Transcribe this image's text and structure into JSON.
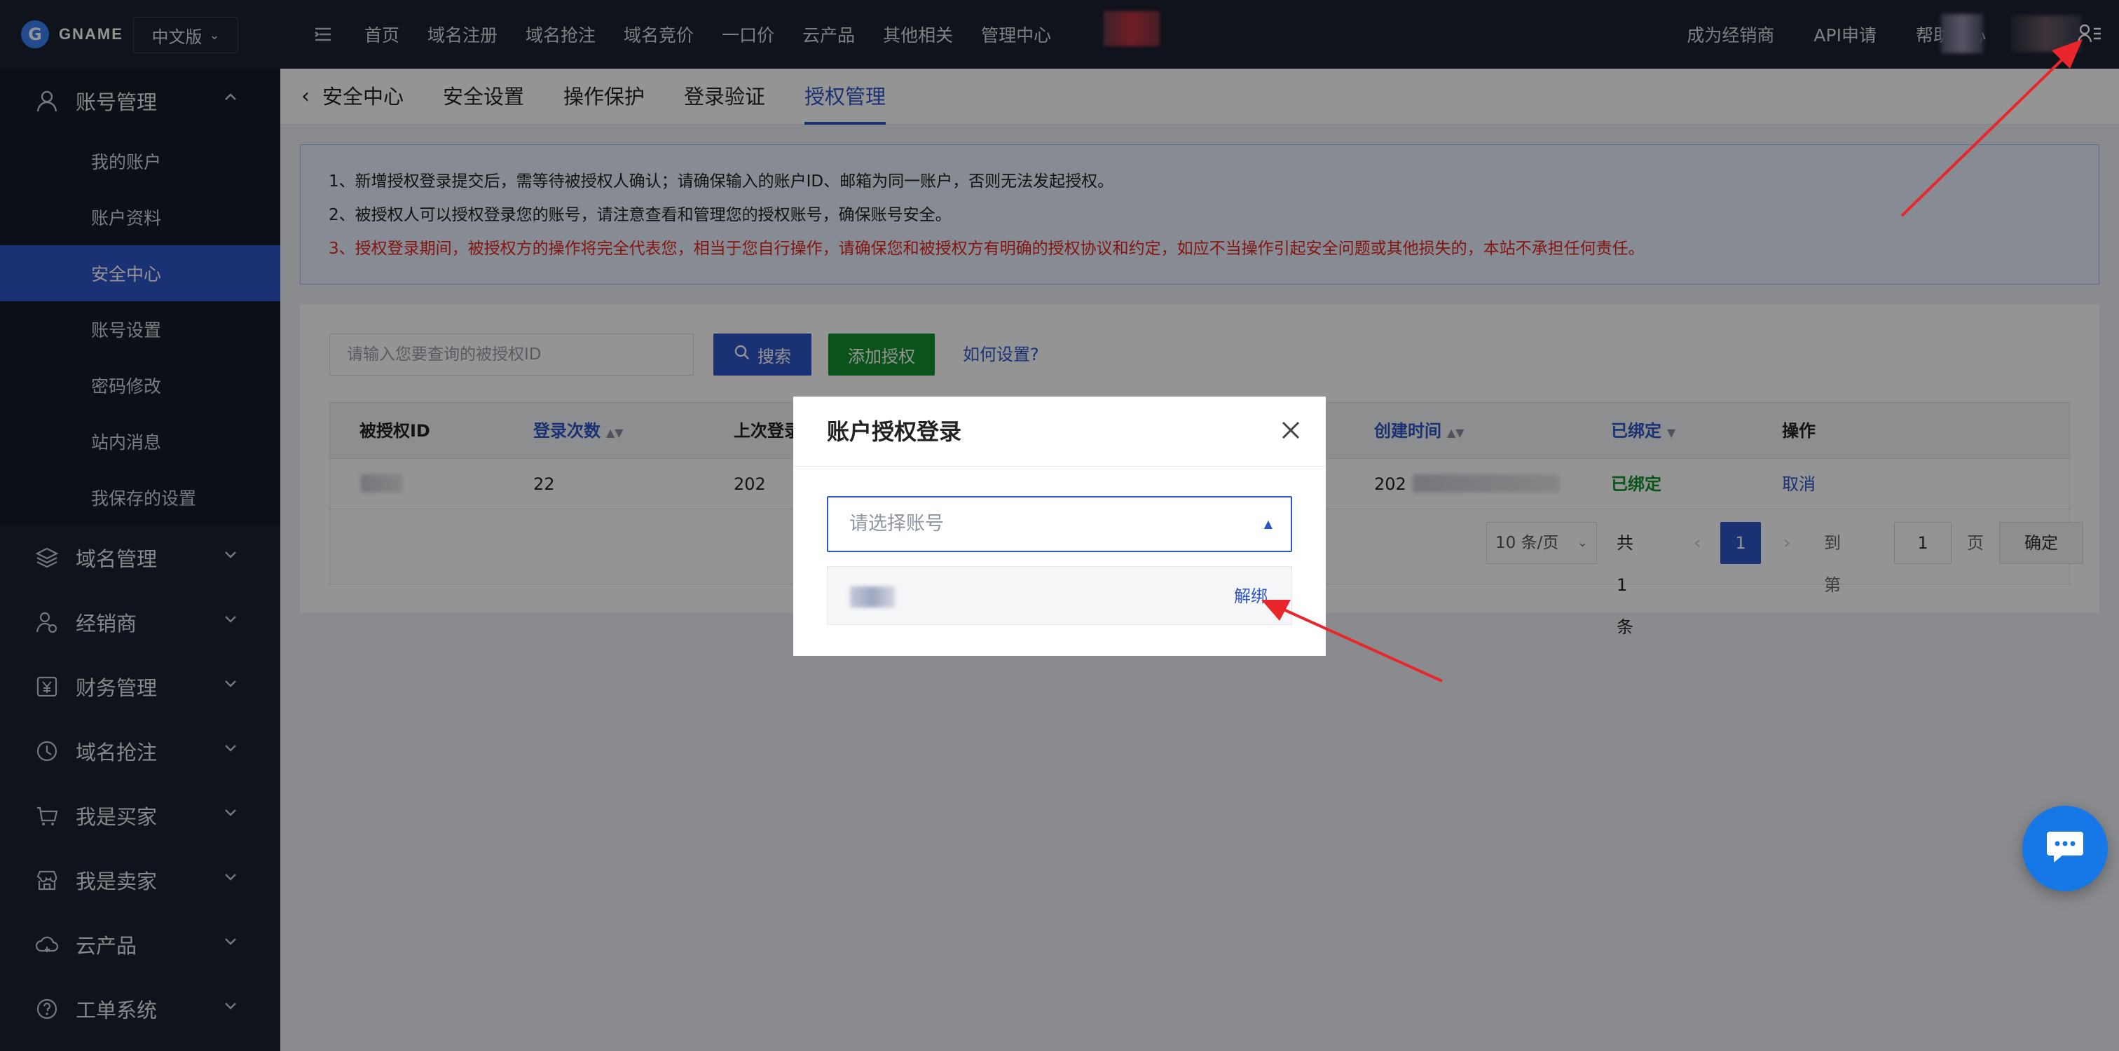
{
  "topbar": {
    "logo_text": "GNAME",
    "language": "中文版",
    "nav": [
      "首页",
      "域名注册",
      "域名抢注",
      "域名竞价",
      "一口价",
      "云产品",
      "其他相关",
      "管理中心"
    ],
    "nav_right": [
      "成为经销商",
      "API申请",
      "帮助中心"
    ],
    "icons": [
      "menu-toggle-icon",
      "user-menu-icon"
    ]
  },
  "sidebar": {
    "account_group": "账号管理",
    "account_items": [
      "我的账户",
      "账户资料",
      "安全中心",
      "账号设置",
      "密码修改",
      "站内消息",
      "我保存的设置"
    ],
    "active_item": "安全中心",
    "groups": [
      "域名管理",
      "经销商",
      "财务管理",
      "域名抢注",
      "我是买家",
      "我是卖家",
      "云产品",
      "工单系统"
    ]
  },
  "tabs": {
    "back": "安全中心",
    "items": [
      "安全设置",
      "操作保护",
      "登录验证",
      "授权管理"
    ],
    "active": "授权管理"
  },
  "notice": {
    "line1": "1、新增授权登录提交后，需等待被授权人确认；请确保输入的账户ID、邮箱为同一账户，否则无法发起授权。",
    "line2": "2、被授权人可以授权登录您的账号，请注意查看和管理您的授权账号，确保账号安全。",
    "line3": "3、授权登录期间，被授权方的操作将完全代表您，相当于您自行操作，请确保您和被授权方有明确的授权协议和约定，如应不当操作引起安全问题或其他损失的，本站不承担任何责任。"
  },
  "search": {
    "placeholder": "请输入您要查询的被授权ID",
    "search_label": "搜索",
    "add_label": "添加授权",
    "how_label": "如何设置?"
  },
  "table": {
    "headers": {
      "id": "被授权ID",
      "logins": "登录次数",
      "last_login": "上次登录",
      "created": "创建时间",
      "status": "已绑定",
      "action": "操作"
    },
    "row": {
      "logins": "22",
      "last_login": "202",
      "created": "202",
      "status": "已绑定",
      "action": "取消"
    }
  },
  "pager": {
    "per_page": "10 条/页",
    "total": "共 1 条",
    "current": "1",
    "goto_label": "到第",
    "goto_value": "1",
    "page_suffix": "页",
    "confirm": "确定"
  },
  "modal": {
    "title": "账户授权登录",
    "select_placeholder": "请选择账号",
    "unbind": "解绑"
  },
  "colors": {
    "primary": "#2e55c6",
    "success": "#12912f",
    "danger": "#e3271f",
    "dark": "#1b2130",
    "annotation": "#e8262b"
  }
}
